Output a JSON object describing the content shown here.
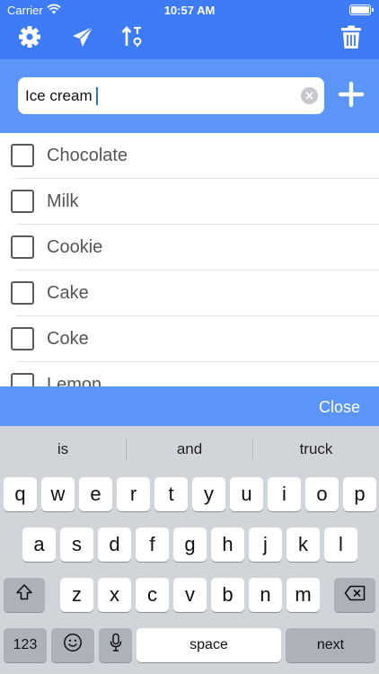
{
  "status": {
    "carrier": "Carrier",
    "time": "10:57 AM"
  },
  "toolbar": {
    "icons": [
      "gear-icon",
      "send-icon",
      "sort-icon",
      "trash-icon"
    ],
    "accent": "#3d7cf6"
  },
  "input": {
    "value": "Ice cream",
    "add_icon": "plus-icon"
  },
  "list": {
    "items": [
      "Chocolate",
      "Milk",
      "Cookie",
      "Cake",
      "Coke",
      "Lemon"
    ]
  },
  "close_label": "Close",
  "keyboard": {
    "suggestions": [
      "is",
      "and",
      "truck"
    ],
    "row1": [
      "q",
      "w",
      "e",
      "r",
      "t",
      "y",
      "u",
      "i",
      "o",
      "p"
    ],
    "row2": [
      "a",
      "s",
      "d",
      "f",
      "g",
      "h",
      "j",
      "k",
      "l"
    ],
    "row3": [
      "z",
      "x",
      "c",
      "v",
      "b",
      "n",
      "m"
    ],
    "numbers_label": "123",
    "space_label": "space",
    "next_label": "next"
  }
}
